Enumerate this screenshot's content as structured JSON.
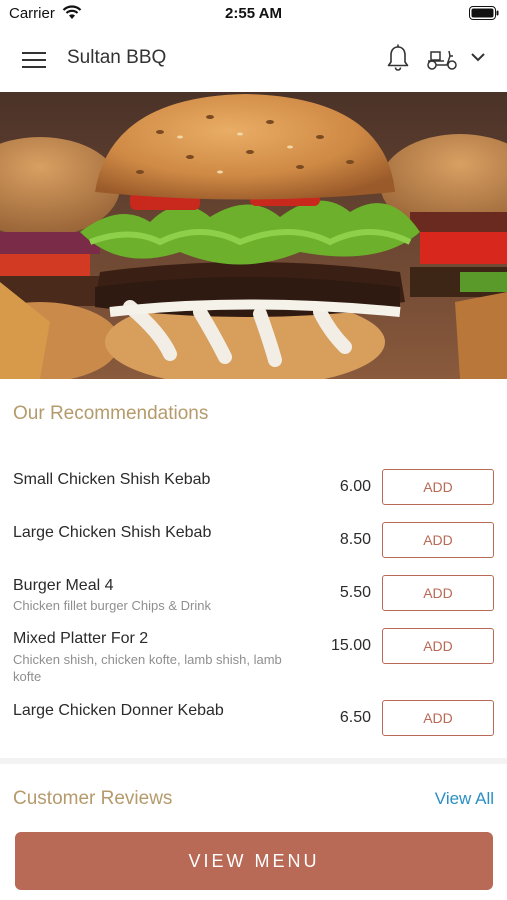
{
  "status_bar": {
    "carrier": "Carrier",
    "time": "2:55 AM"
  },
  "header": {
    "title": "Sultan BBQ",
    "icons": [
      "menu-icon",
      "bell-icon",
      "scooter-icon",
      "chevron-down-icon"
    ]
  },
  "recommendations": {
    "title": "Our Recommendations",
    "items": [
      {
        "name": "Small Chicken Shish Kebab",
        "description": "",
        "price": "6.00",
        "action": "ADD"
      },
      {
        "name": "Large Chicken Shish Kebab",
        "description": "",
        "price": "8.50",
        "action": "ADD"
      },
      {
        "name": "Burger Meal 4",
        "description": "Chicken fillet burger  Chips & Drink",
        "price": "5.50",
        "action": "ADD"
      },
      {
        "name": "Mixed Platter For 2",
        "description": "Chicken shish, chicken kofte, lamb shish, lamb kofte",
        "price": "15.00",
        "action": "ADD"
      },
      {
        "name": "Large Chicken Donner Kebab",
        "description": "",
        "price": "6.50",
        "action": "ADD"
      }
    ]
  },
  "reviews": {
    "title": "Customer Reviews",
    "view_all": "View All"
  },
  "cta": {
    "label": "VIEW MENU"
  },
  "colors": {
    "accent": "#b86a56",
    "section_title": "#b59a6c",
    "link": "#2a8fc6"
  }
}
